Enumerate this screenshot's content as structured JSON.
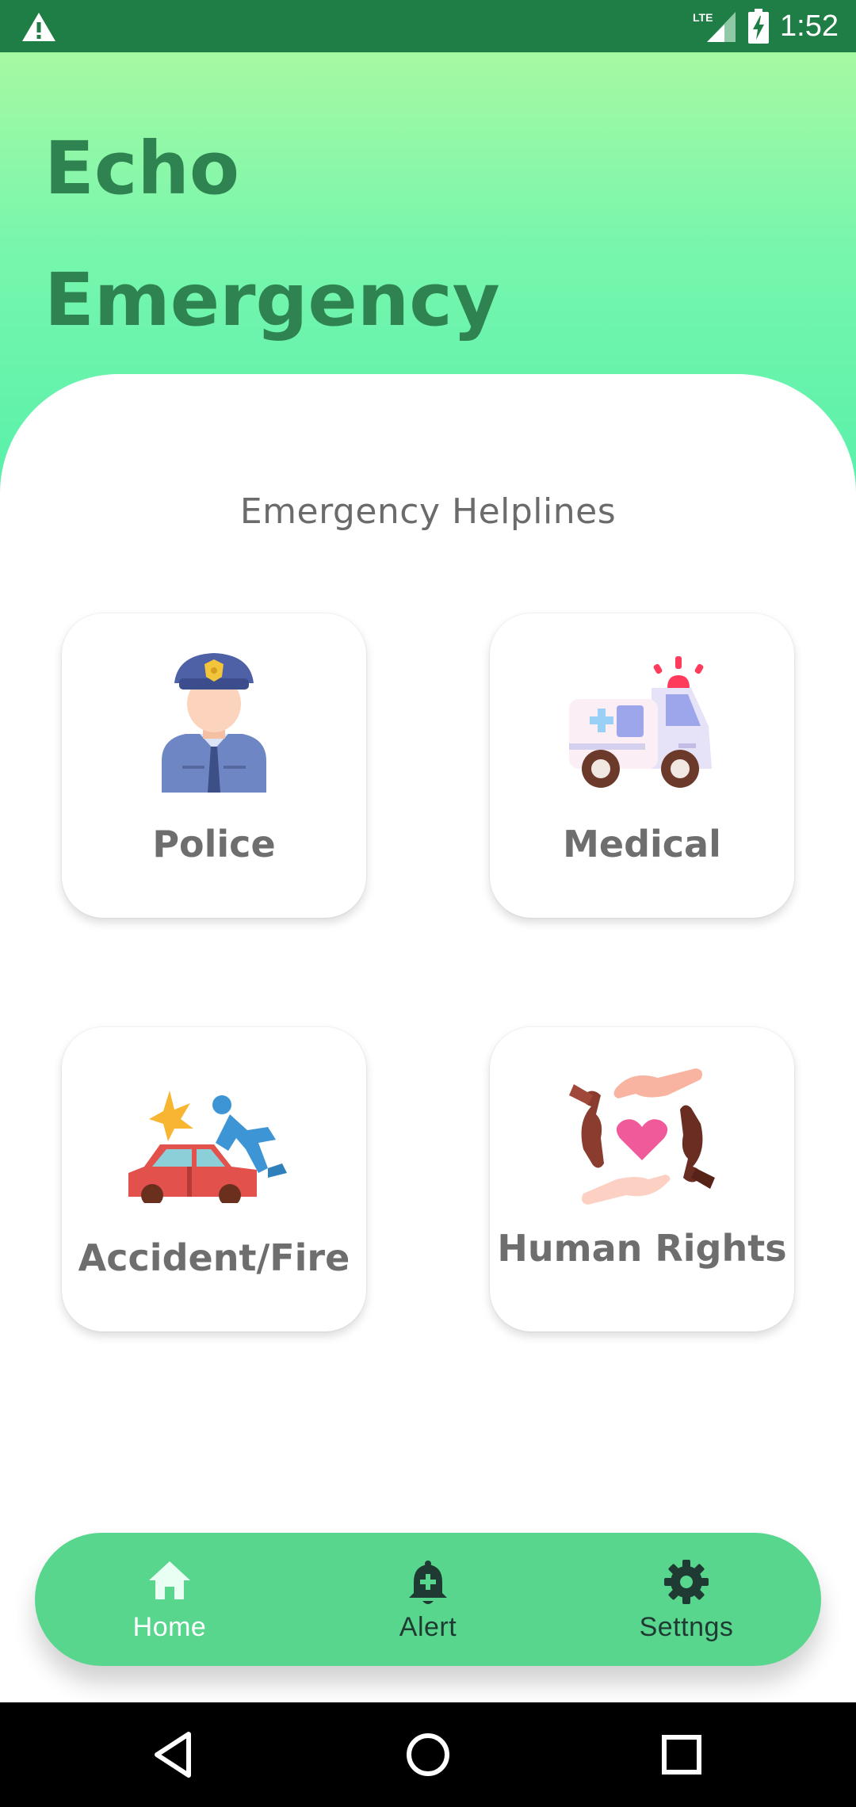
{
  "status_bar": {
    "time": "1:52",
    "network": "LTE",
    "icons": [
      "warning-icon",
      "lte-signal-icon",
      "battery-charging-icon"
    ]
  },
  "app": {
    "title_line1": "Echo",
    "title_line2": "Emergency"
  },
  "main": {
    "section_title": "Emergency Helplines",
    "cards": [
      {
        "label": "Police",
        "icon": "police-officer-icon"
      },
      {
        "label": "Medical",
        "icon": "ambulance-icon"
      },
      {
        "label": "Accident/Fire",
        "icon": "car-accident-icon"
      },
      {
        "label": "Human Rights",
        "icon": "human-rights-hands-icon"
      }
    ]
  },
  "bottom_nav": {
    "items": [
      {
        "label": "Home",
        "icon": "home-icon",
        "active": true
      },
      {
        "label": "Alert",
        "icon": "alert-bell-icon",
        "active": false
      },
      {
        "label": "Settngs",
        "icon": "gear-icon",
        "active": false
      }
    ]
  },
  "system_nav": {
    "buttons": [
      "back-icon",
      "home-circle-icon",
      "recents-icon"
    ]
  },
  "colors": {
    "status_bar": "#1e7e45",
    "header_top": "#a6f9a2",
    "header_bottom": "#58f0a9",
    "title": "#2f8351",
    "nav_bg": "#58d68d",
    "label_text": "#6e6e6e"
  }
}
